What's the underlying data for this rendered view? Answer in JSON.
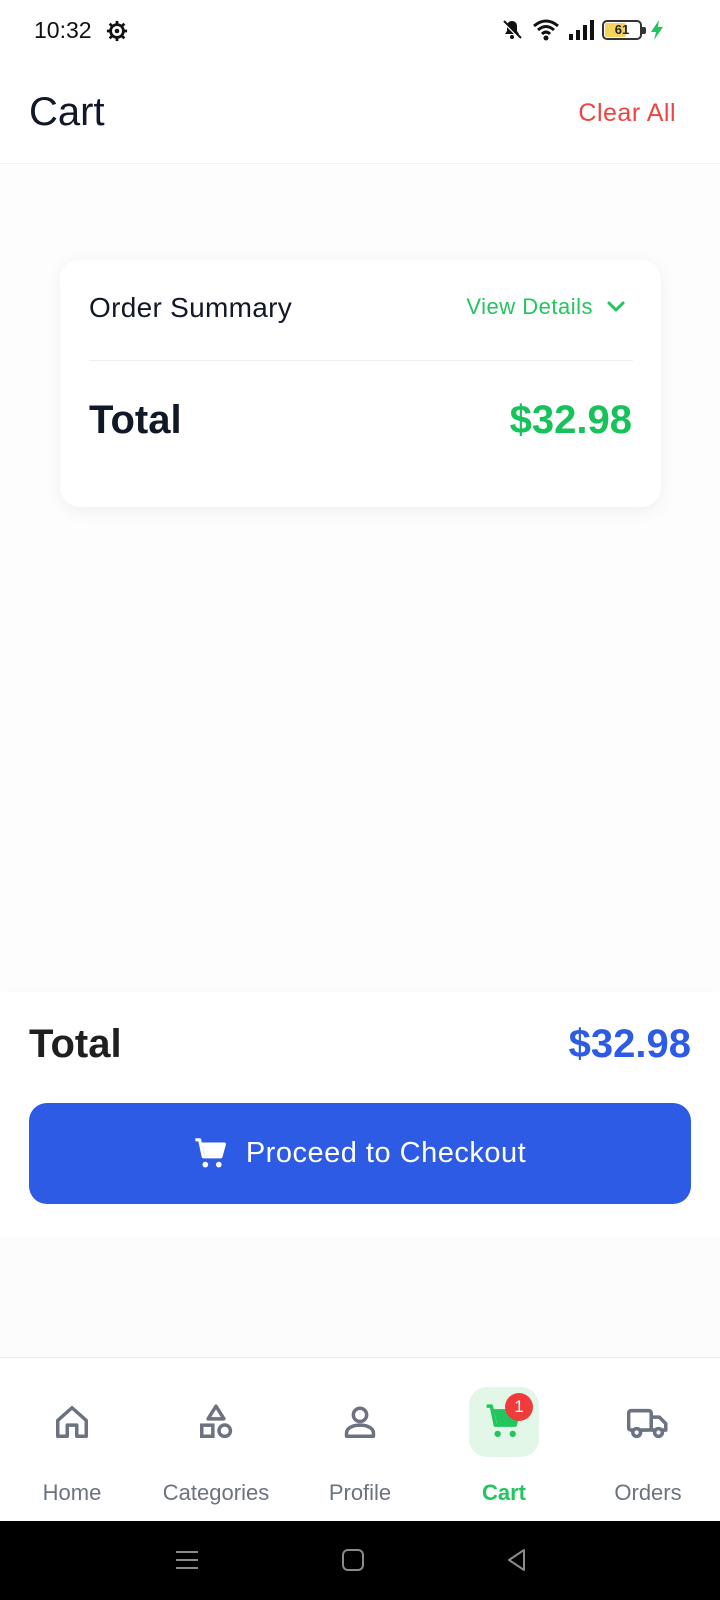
{
  "status_bar": {
    "time": "10:32",
    "battery_percent": "61",
    "battery_level": 0.61,
    "icons": [
      "gear-icon",
      "bell-off-icon",
      "wifi-icon",
      "signal-icon",
      "battery-icon",
      "charging-icon"
    ]
  },
  "header": {
    "title": "Cart",
    "clear_all_label": "Clear All"
  },
  "summary": {
    "title": "Order Summary",
    "view_details_label": "View Details",
    "total_label": "Total",
    "total_value": "$32.98"
  },
  "checkout": {
    "total_label": "Total",
    "total_value": "$32.98",
    "button_label": "Proceed to Checkout"
  },
  "bottom_nav": {
    "items": [
      {
        "label": "Home",
        "icon": "home-icon"
      },
      {
        "label": "Categories",
        "icon": "categories-icon"
      },
      {
        "label": "Profile",
        "icon": "profile-icon"
      },
      {
        "label": "Cart",
        "icon": "cart-icon",
        "active": true
      },
      {
        "label": "Orders",
        "icon": "truck-icon"
      }
    ],
    "cart_badge": "1"
  },
  "colors": {
    "accent_green": "#22c55e",
    "primary_blue": "#2d5be3",
    "danger_red": "#ef4444"
  }
}
